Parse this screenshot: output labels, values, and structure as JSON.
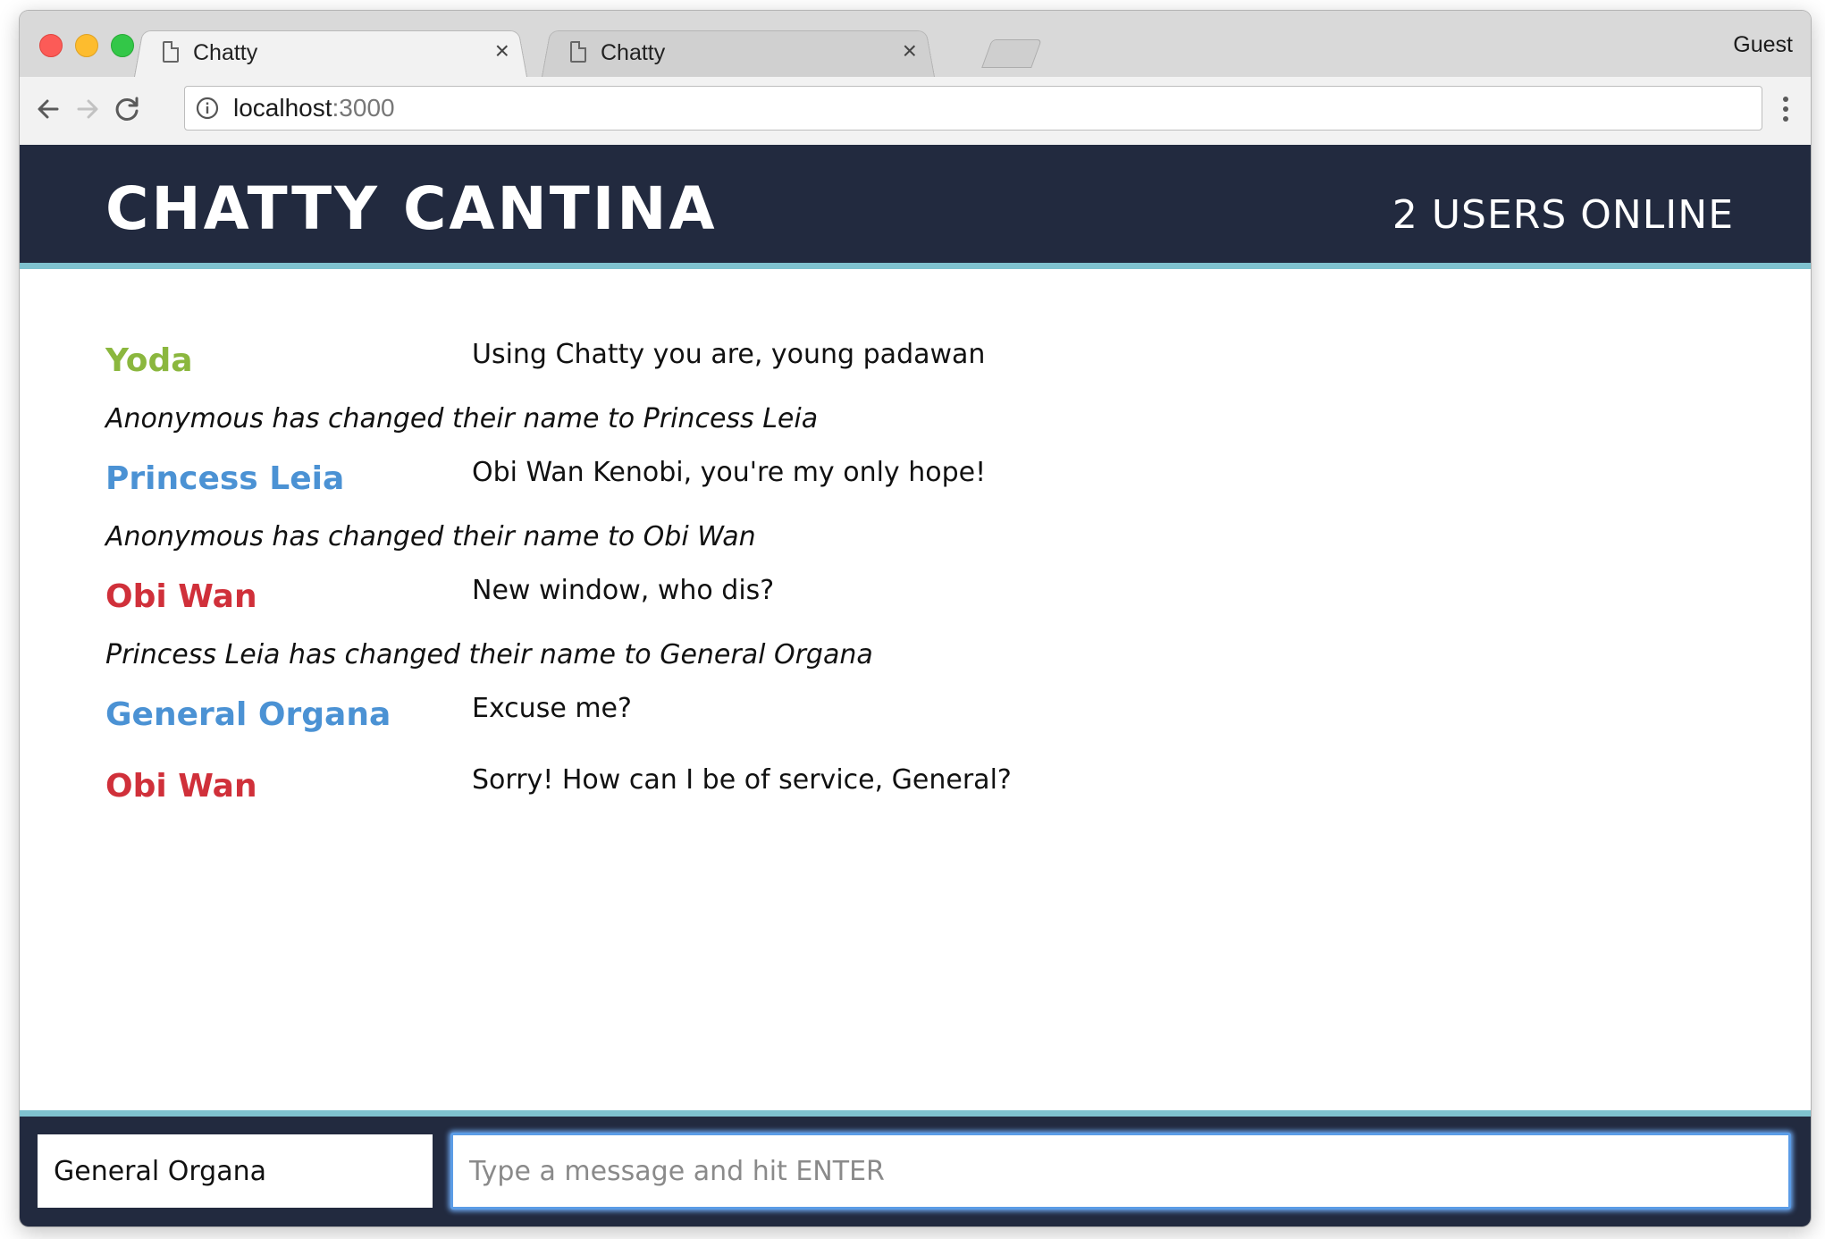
{
  "browser": {
    "tabs": [
      {
        "title": "Chatty",
        "close": "×",
        "active": true
      },
      {
        "title": "Chatty",
        "close": "×",
        "active": false
      }
    ],
    "profile": "Guest",
    "url": {
      "host": "localhost",
      "port": ":3000"
    }
  },
  "app": {
    "brand": "CHATTY CANTINA",
    "users_online": "2 USERS ONLINE",
    "colors": {
      "header_bg": "#222a3f",
      "accent_border": "#7fc2cf",
      "green_user": "#8bb73e",
      "blue_user": "#4b92d4",
      "red_user": "#d0303a"
    },
    "messages": [
      {
        "type": "message",
        "user": "Yoda",
        "color": "#8bb73e",
        "content": "Using Chatty you are, young padawan"
      },
      {
        "type": "notification",
        "content": "Anonymous has changed their name to Princess Leia"
      },
      {
        "type": "message",
        "user": "Princess Leia",
        "color": "#4b92d4",
        "content": "Obi Wan Kenobi, you're my only hope!"
      },
      {
        "type": "notification",
        "content": "Anonymous has changed their name to Obi Wan"
      },
      {
        "type": "message",
        "user": "Obi Wan",
        "color": "#d0303a",
        "content": "New window, who dis?"
      },
      {
        "type": "notification",
        "content": "Princess Leia has changed their name to General Organa"
      },
      {
        "type": "message",
        "user": "General Organa",
        "color": "#4b92d4",
        "content": "Excuse me?"
      },
      {
        "type": "message",
        "user": "Obi Wan",
        "color": "#d0303a",
        "content": "Sorry! How can I be of service, General?"
      }
    ],
    "footer": {
      "username_value": "General Organa",
      "message_placeholder": "Type a message and hit ENTER"
    }
  }
}
